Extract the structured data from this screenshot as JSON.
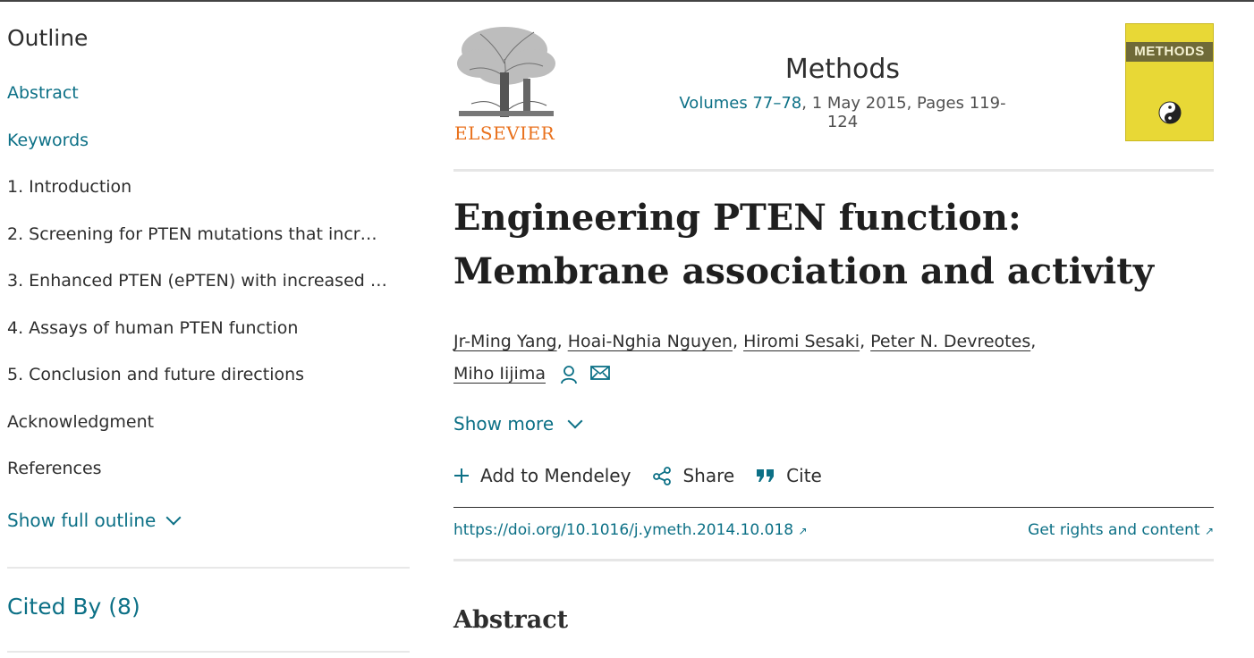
{
  "outline": {
    "heading": "Outline",
    "items": [
      {
        "label": "Abstract",
        "link": true
      },
      {
        "label": "Keywords",
        "link": true
      },
      {
        "label": "1. Introduction",
        "link": false
      },
      {
        "label": "2. Screening for PTEN mutations that incr…",
        "link": false
      },
      {
        "label": "3. Enhanced PTEN (ePTEN) with increased …",
        "link": false
      },
      {
        "label": "4. Assays of human PTEN function",
        "link": false
      },
      {
        "label": "5. Conclusion and future directions",
        "link": false
      },
      {
        "label": "Acknowledgment",
        "link": false
      },
      {
        "label": "References",
        "link": false
      }
    ],
    "show_full": "Show full outline",
    "cited_by": "Cited By (8)"
  },
  "publisher": {
    "name": "ELSEVIER",
    "color": "#e9711c"
  },
  "journal": {
    "title": "Methods",
    "volume": "Volumes 77–78",
    "meta_rest": ", 1 May 2015, Pages 119-124",
    "cover_title": "METHODS"
  },
  "article": {
    "title": "Engineering PTEN function: Membrane association and activity",
    "authors": [
      "Jr-Ming Yang",
      "Hoai-Nghia Nguyen",
      "Hiromi Sesaki",
      "Peter N. Devreotes",
      "Miho Iijima"
    ],
    "show_more": "Show more",
    "actions": {
      "mendeley": "Add to Mendeley",
      "share": "Share",
      "cite": "Cite"
    },
    "doi": "https://doi.org/10.1016/j.ymeth.2014.10.018",
    "rights": "Get rights and content",
    "abstract_heading": "Abstract"
  },
  "colors": {
    "link": "#0c7086",
    "text": "#2e2e2e",
    "cover": "#e8d836"
  }
}
